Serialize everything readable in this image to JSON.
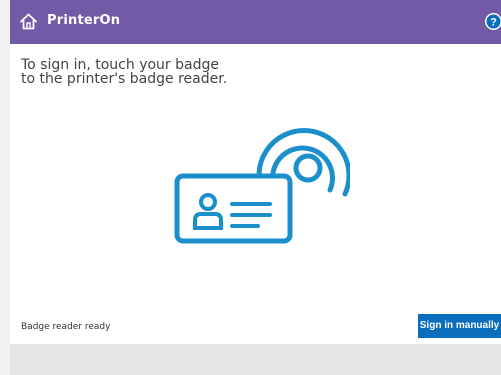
{
  "header": {
    "title": "PrinterOn",
    "home_icon": "home-icon",
    "help_icon": "help-icon",
    "help_glyph": "?",
    "background_color": "#725aa6"
  },
  "main": {
    "instruction_lines": [
      "To sign in, touch your badge",
      "to the printer's badge reader."
    ],
    "illustration_icon": "badge-reader-icon",
    "accent_color": "#1b8fcb"
  },
  "footer": {
    "status_text": "Badge reader ready",
    "sign_in_label": "Sign in manually",
    "button_color": "#0a6ebd"
  }
}
